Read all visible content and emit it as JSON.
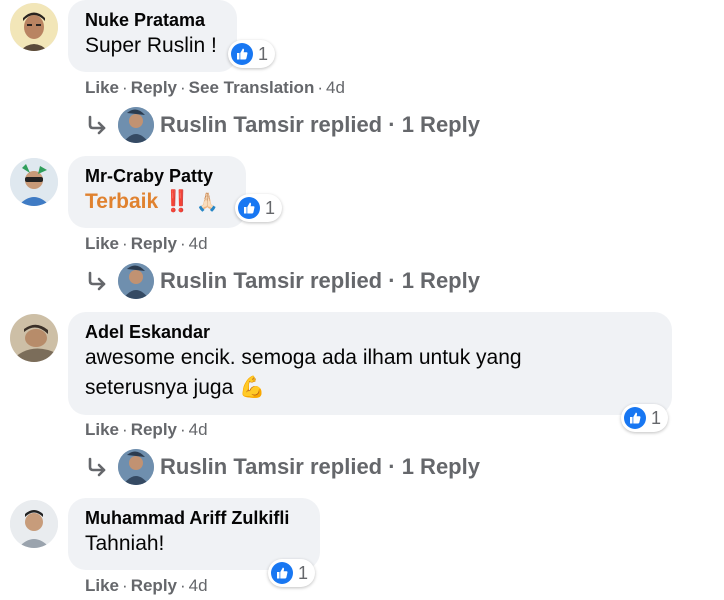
{
  "comments": [
    {
      "author": "Nuke Pratama",
      "text": "Super Ruslin !",
      "reaction_count": "1",
      "actions": {
        "like": "Like",
        "reply": "Reply",
        "see_translation": "See Translation",
        "time": "4d"
      },
      "replies": {
        "name": "Ruslin Tamsir",
        "suffix": "replied",
        "count": "1 Reply"
      }
    },
    {
      "author": "Mr-Craby Patty",
      "text": "Terbaik",
      "emoji_1": "‼️",
      "emoji_2": "🙏🏻",
      "reaction_count": "1",
      "actions": {
        "like": "Like",
        "reply": "Reply",
        "time": "4d"
      },
      "replies": {
        "name": "Ruslin Tamsir",
        "suffix": "replied",
        "count": "1 Reply"
      }
    },
    {
      "author": "Adel Eskandar",
      "text": "awesome encik. semoga ada ilham untuk yang seterusnya juga",
      "emoji_1": "💪",
      "reaction_count": "1",
      "actions": {
        "like": "Like",
        "reply": "Reply",
        "time": "4d"
      },
      "replies": {
        "name": "Ruslin Tamsir",
        "suffix": "replied",
        "count": "1 Reply"
      }
    },
    {
      "author": "Muhammad Ariff Zulkifli",
      "text": "Tahniah!",
      "reaction_count": "1",
      "actions": {
        "like": "Like",
        "reply": "Reply",
        "time": "4d"
      }
    }
  ],
  "separator": "·",
  "icons": {
    "reaction": "like-reaction-icon",
    "reply": "reply-arrow-icon"
  },
  "colors": {
    "like_blue": "#1877f2",
    "bubble_bg": "#f0f2f5",
    "meta_gray": "#65676b",
    "highlight": "#e0822f"
  }
}
